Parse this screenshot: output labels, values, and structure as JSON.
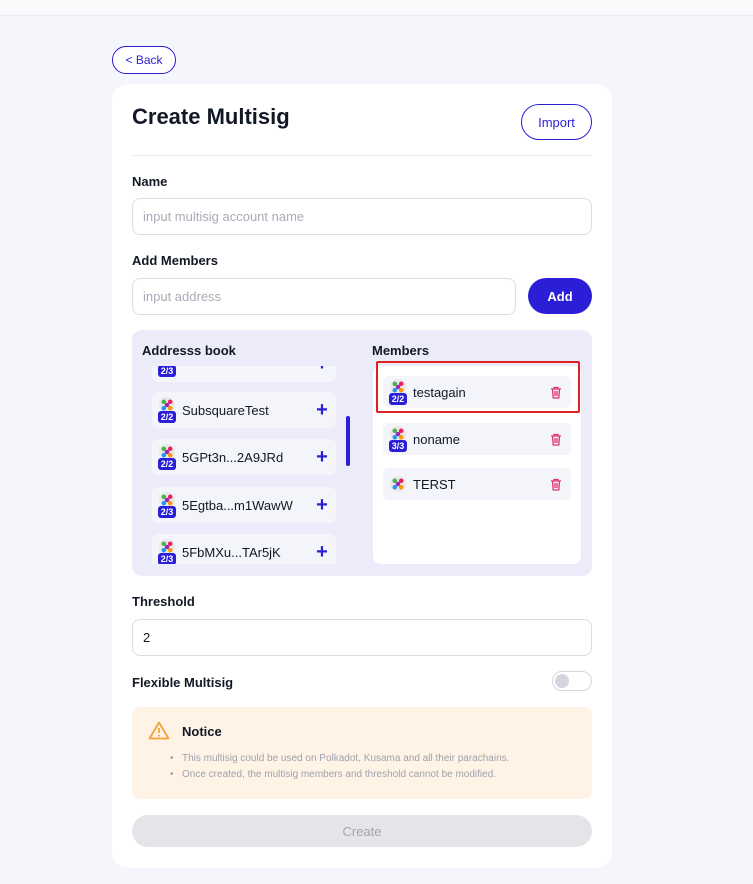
{
  "back": {
    "label": "< Back"
  },
  "header": {
    "title": "Create Multisig",
    "import_label": "Import"
  },
  "name_field": {
    "label": "Name",
    "placeholder": "input multisig account name"
  },
  "members_field": {
    "label": "Add Members",
    "placeholder": "input address",
    "add_label": "Add"
  },
  "address_book": {
    "label": "Addresss book",
    "items": [
      {
        "name": "",
        "badge": "2/3"
      },
      {
        "name": "SubsquareTest",
        "badge": "2/2"
      },
      {
        "name": "5GPt3n...2A9JRd",
        "badge": "2/2"
      },
      {
        "name": "5Egtba...m1WawW",
        "badge": "2/3"
      },
      {
        "name": "5FbMXu...TAr5jK",
        "badge": "2/3"
      }
    ]
  },
  "members": {
    "label": "Members",
    "items": [
      {
        "name": "testagain",
        "badge": "2/2"
      },
      {
        "name": "noname",
        "badge": "3/3"
      },
      {
        "name": "TERST",
        "badge": ""
      }
    ]
  },
  "threshold": {
    "label": "Threshold",
    "value": "2"
  },
  "flexible": {
    "label": "Flexible Multisig",
    "enabled": false
  },
  "notice": {
    "title": "Notice",
    "items": [
      "This multisig could be used on Polkadot, Kusama and all their parachains.",
      "Once created, the multisig members and threshold cannot be modified."
    ]
  },
  "create": {
    "label": "Create"
  },
  "colors": {
    "accent": "#2a1fd6",
    "danger": "#e0336b",
    "notice_bg": "#fff3e6",
    "warning": "#f2a33a"
  }
}
